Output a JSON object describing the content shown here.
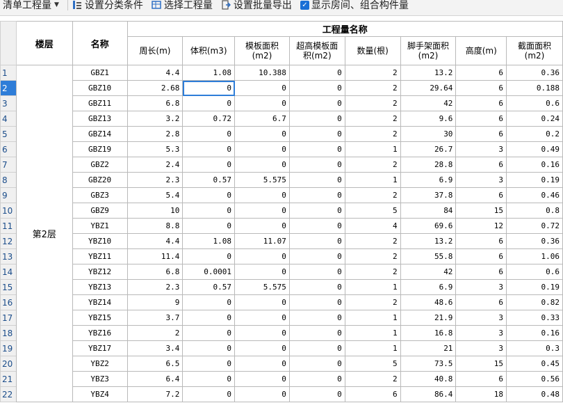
{
  "toolbar": {
    "qty_select": "清单工程量",
    "classify": "设置分类条件",
    "pick": "选择工程量",
    "export": "设置批量导出",
    "show_rooms": "显示房间、组合构件量"
  },
  "table": {
    "header_floor": "楼层",
    "header_name": "名称",
    "header_group": "工程量名称",
    "columns": [
      "周长(m)",
      "体积(m3)",
      "模板面积(m2)",
      "超高模板面积(m2)",
      "数量(根)",
      "脚手架面积(m2)",
      "高度(m)",
      "截面面积(m2)"
    ],
    "floor_label": "第2层",
    "rows": [
      {
        "idx": "1",
        "name": "GBZ1",
        "v": [
          "4.4",
          "1.08",
          "10.388",
          "0",
          "2",
          "13.2",
          "6",
          "0.36"
        ]
      },
      {
        "idx": "2",
        "name": "GBZ10",
        "v": [
          "2.68",
          "0",
          "0",
          "0",
          "2",
          "29.64",
          "6",
          "0.188"
        ]
      },
      {
        "idx": "3",
        "name": "GBZ11",
        "v": [
          "6.8",
          "0",
          "0",
          "0",
          "2",
          "42",
          "6",
          "0.6"
        ]
      },
      {
        "idx": "4",
        "name": "GBZ13",
        "v": [
          "3.2",
          "0.72",
          "6.7",
          "0",
          "2",
          "9.6",
          "6",
          "0.24"
        ]
      },
      {
        "idx": "5",
        "name": "GBZ14",
        "v": [
          "2.8",
          "0",
          "0",
          "0",
          "2",
          "30",
          "6",
          "0.2"
        ]
      },
      {
        "idx": "6",
        "name": "GBZ19",
        "v": [
          "5.3",
          "0",
          "0",
          "0",
          "1",
          "26.7",
          "3",
          "0.49"
        ]
      },
      {
        "idx": "7",
        "name": "GBZ2",
        "v": [
          "2.4",
          "0",
          "0",
          "0",
          "2",
          "28.8",
          "6",
          "0.16"
        ]
      },
      {
        "idx": "8",
        "name": "GBZ20",
        "v": [
          "2.3",
          "0.57",
          "5.575",
          "0",
          "1",
          "6.9",
          "3",
          "0.19"
        ]
      },
      {
        "idx": "9",
        "name": "GBZ3",
        "v": [
          "5.4",
          "0",
          "0",
          "0",
          "2",
          "37.8",
          "6",
          "0.46"
        ]
      },
      {
        "idx": "10",
        "name": "GBZ9",
        "v": [
          "10",
          "0",
          "0",
          "0",
          "5",
          "84",
          "15",
          "0.8"
        ]
      },
      {
        "idx": "11",
        "name": "YBZ1",
        "v": [
          "8.8",
          "0",
          "0",
          "0",
          "4",
          "69.6",
          "12",
          "0.72"
        ]
      },
      {
        "idx": "12",
        "name": "YBZ10",
        "v": [
          "4.4",
          "1.08",
          "11.07",
          "0",
          "2",
          "13.2",
          "6",
          "0.36"
        ]
      },
      {
        "idx": "13",
        "name": "YBZ11",
        "v": [
          "11.4",
          "0",
          "0",
          "0",
          "2",
          "55.8",
          "6",
          "1.06"
        ]
      },
      {
        "idx": "14",
        "name": "YBZ12",
        "v": [
          "6.8",
          "0.0001",
          "0",
          "0",
          "2",
          "42",
          "6",
          "0.6"
        ]
      },
      {
        "idx": "15",
        "name": "YBZ13",
        "v": [
          "2.3",
          "0.57",
          "5.575",
          "0",
          "1",
          "6.9",
          "3",
          "0.19"
        ]
      },
      {
        "idx": "16",
        "name": "YBZ14",
        "v": [
          "9",
          "0",
          "0",
          "0",
          "2",
          "48.6",
          "6",
          "0.82"
        ]
      },
      {
        "idx": "17",
        "name": "YBZ15",
        "v": [
          "3.7",
          "0",
          "0",
          "0",
          "1",
          "21.9",
          "3",
          "0.33"
        ]
      },
      {
        "idx": "18",
        "name": "YBZ16",
        "v": [
          "2",
          "0",
          "0",
          "0",
          "1",
          "16.8",
          "3",
          "0.16"
        ]
      },
      {
        "idx": "19",
        "name": "YBZ17",
        "v": [
          "3.4",
          "0",
          "0",
          "0",
          "1",
          "21",
          "3",
          "0.3"
        ]
      },
      {
        "idx": "20",
        "name": "YBZ2",
        "v": [
          "6.5",
          "0",
          "0",
          "0",
          "5",
          "73.5",
          "15",
          "0.45"
        ]
      },
      {
        "idx": "21",
        "name": "YBZ3",
        "v": [
          "6.4",
          "0",
          "0",
          "0",
          "2",
          "40.8",
          "6",
          "0.56"
        ]
      },
      {
        "idx": "22",
        "name": "YBZ4",
        "v": [
          "7.2",
          "0",
          "0",
          "0",
          "6",
          "86.4",
          "18",
          "0.48"
        ]
      }
    ]
  }
}
